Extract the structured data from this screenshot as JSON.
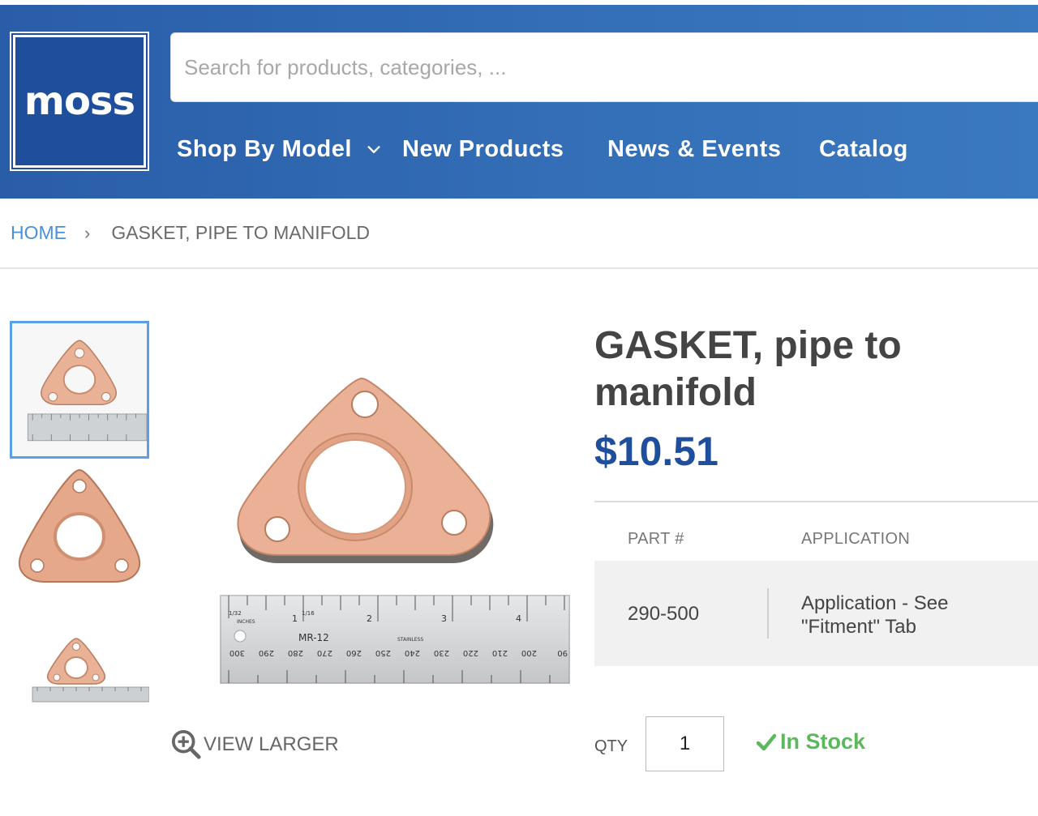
{
  "brand": {
    "logo_text": "moss",
    "primary_color": "#1f4f9c",
    "accent_color": "#4a90d9"
  },
  "search": {
    "placeholder": "Search for products, categories, ..."
  },
  "nav": {
    "items": [
      {
        "label": "Shop By Model",
        "has_dropdown": true,
        "icon": "chevron-down-icon"
      },
      {
        "label": "New Products"
      },
      {
        "label": "News & Events"
      },
      {
        "label": "Catalog"
      }
    ]
  },
  "breadcrumb": {
    "home": "HOME",
    "separator": "›",
    "current": "GASKET, PIPE TO MANIFOLD"
  },
  "gallery": {
    "thumbnail_count": 3,
    "active_index": 0,
    "view_larger_label": "VIEW LARGER",
    "ruler_labels": [
      "1/32",
      "1/16",
      "1",
      "2",
      "3",
      "4",
      "INCHES",
      "MR-12",
      "STAINLESS",
      "300",
      "290",
      "280",
      "270",
      "260",
      "250",
      "240",
      "230",
      "220",
      "210",
      "200",
      "90"
    ]
  },
  "product": {
    "title": "GASKET, pipe to manifold",
    "price": "$10.51",
    "table": {
      "headers": [
        "PART #",
        "APPLICATION"
      ],
      "rows": [
        {
          "part": "290-500",
          "application": "Application - See \"Fitment\" Tab"
        }
      ]
    },
    "qty_label": "QTY",
    "qty_value": "1",
    "stock_status": "In Stock",
    "stock_color": "#5cb85c"
  }
}
